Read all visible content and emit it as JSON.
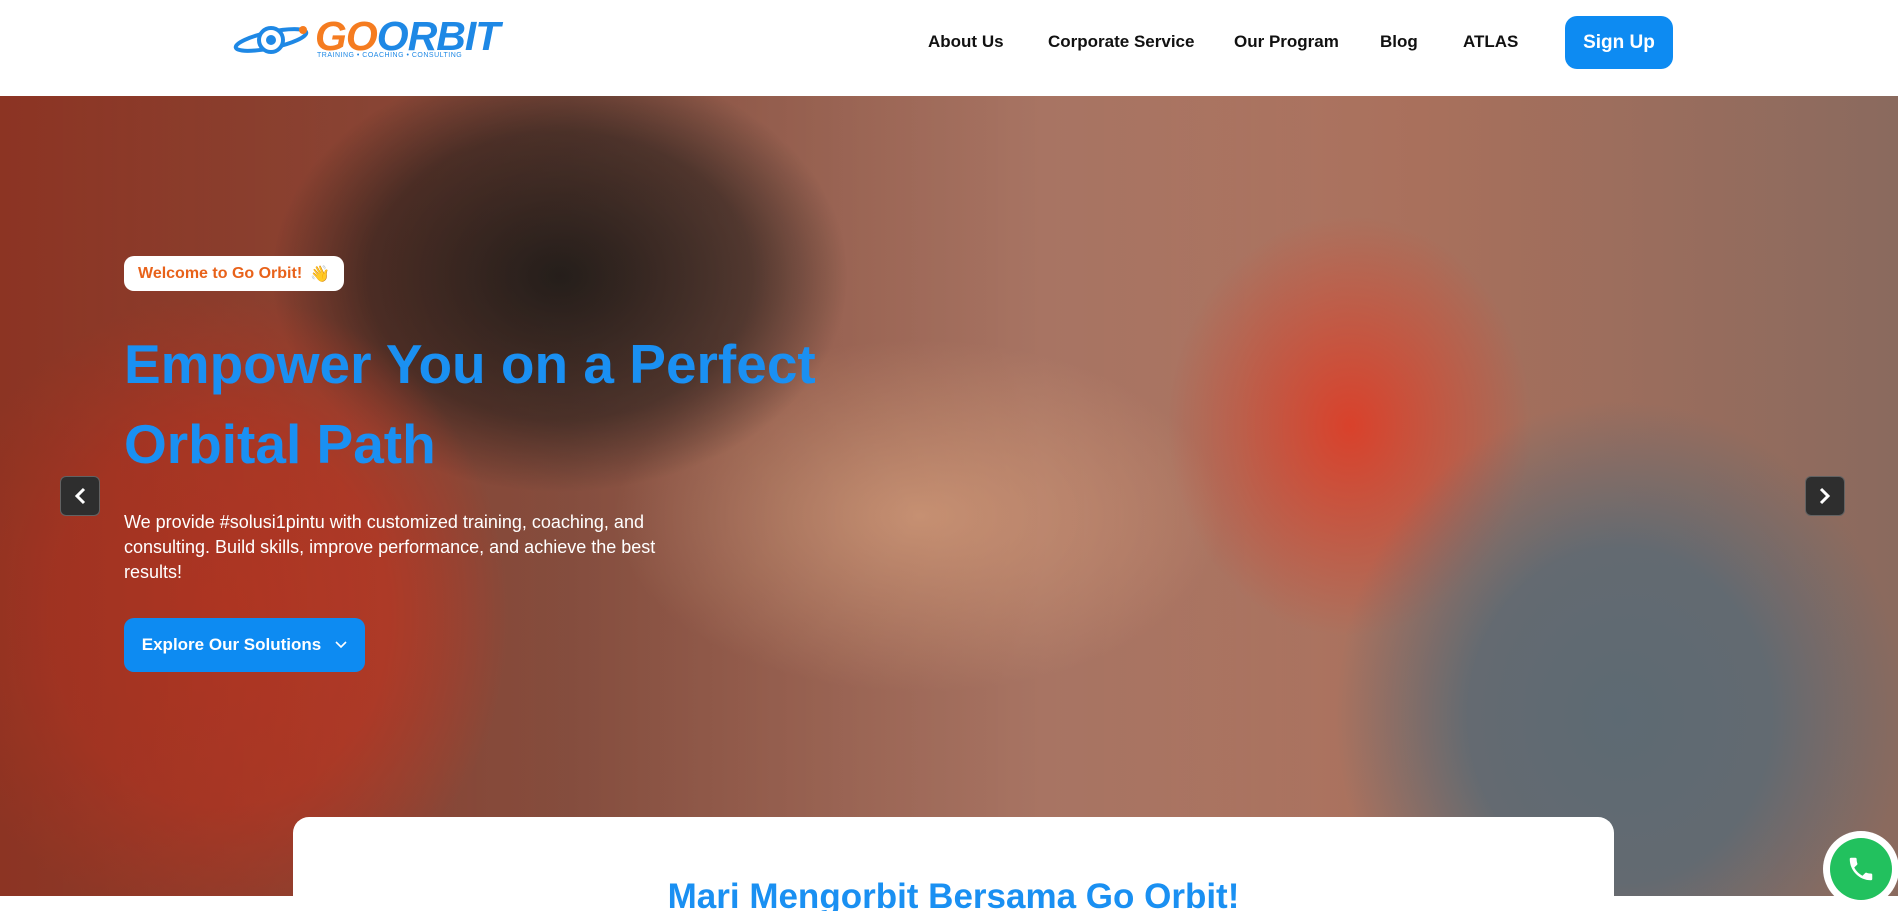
{
  "brand": {
    "logo_go": "GO",
    "logo_orbit": "ORBIT",
    "logo_tagline": "TRAINING • COACHING • CONSULTING"
  },
  "nav": {
    "items": [
      {
        "label": "About Us"
      },
      {
        "label": "Corporate Service"
      },
      {
        "label": "Our Program"
      },
      {
        "label": "Blog"
      },
      {
        "label": "ATLAS"
      }
    ],
    "signup_label": "Sign Up"
  },
  "hero": {
    "badge_text": "Welcome to Go Orbit!",
    "badge_icon": "👋",
    "title": "Empower You on a Perfect Orbital Path",
    "description": "We provide #solusi1pintu with customized training, coaching, and consulting. Build skills, improve performance, and achieve the best results!",
    "cta_label": "Explore Our Solutions",
    "cta_icon": "chevron-down-icon",
    "prev_icon": "chevron-left-icon",
    "next_icon": "chevron-right-icon"
  },
  "section": {
    "title": "Mari Mengorbit Bersama Go Orbit!"
  },
  "colors": {
    "accent": "#0d8bf2",
    "brand_orange": "#f57c20",
    "whatsapp": "#22c15e"
  }
}
